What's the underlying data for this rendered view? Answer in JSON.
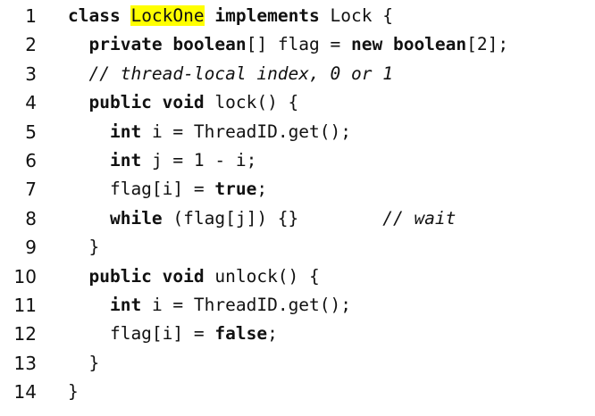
{
  "lines": [
    {
      "num": "1",
      "parts": [
        {
          "t": "class",
          "s": "kw"
        },
        {
          "t": " "
        },
        {
          "t": "LockOne",
          "s": "hl"
        },
        {
          "t": " "
        },
        {
          "t": "implements",
          "s": "kw"
        },
        {
          "t": " Lock {"
        }
      ]
    },
    {
      "num": "2",
      "parts": [
        {
          "t": "  "
        },
        {
          "t": "private boolean",
          "s": "kw"
        },
        {
          "t": "[] flag = "
        },
        {
          "t": "new boolean",
          "s": "kw"
        },
        {
          "t": "[2];"
        }
      ]
    },
    {
      "num": "3",
      "parts": [
        {
          "t": "  "
        },
        {
          "t": "// thread-local index, 0 or 1",
          "s": "cm"
        }
      ]
    },
    {
      "num": "4",
      "parts": [
        {
          "t": "  "
        },
        {
          "t": "public void",
          "s": "kw"
        },
        {
          "t": " lock() {"
        }
      ]
    },
    {
      "num": "5",
      "parts": [
        {
          "t": "    "
        },
        {
          "t": "int",
          "s": "kw"
        },
        {
          "t": " i = ThreadID.get();"
        }
      ]
    },
    {
      "num": "6",
      "parts": [
        {
          "t": "    "
        },
        {
          "t": "int",
          "s": "kw"
        },
        {
          "t": " j = 1 - i;"
        }
      ]
    },
    {
      "num": "7",
      "parts": [
        {
          "t": "    flag[i] = "
        },
        {
          "t": "true",
          "s": "kw"
        },
        {
          "t": ";"
        }
      ]
    },
    {
      "num": "8",
      "parts": [
        {
          "t": "    "
        },
        {
          "t": "while",
          "s": "kw"
        },
        {
          "t": " (flag[j]) {}        "
        },
        {
          "t": "// wait",
          "s": "cm"
        }
      ]
    },
    {
      "num": "9",
      "parts": [
        {
          "t": "  }"
        }
      ]
    },
    {
      "num": "10",
      "parts": [
        {
          "t": "  "
        },
        {
          "t": "public void",
          "s": "kw"
        },
        {
          "t": " unlock() {"
        }
      ]
    },
    {
      "num": "11",
      "parts": [
        {
          "t": "    "
        },
        {
          "t": "int",
          "s": "kw"
        },
        {
          "t": " i = ThreadID.get();"
        }
      ]
    },
    {
      "num": "12",
      "parts": [
        {
          "t": "    flag[i] = "
        },
        {
          "t": "false",
          "s": "kw"
        },
        {
          "t": ";"
        }
      ]
    },
    {
      "num": "13",
      "parts": [
        {
          "t": "  }"
        }
      ]
    },
    {
      "num": "14",
      "parts": [
        {
          "t": "}"
        }
      ]
    }
  ]
}
